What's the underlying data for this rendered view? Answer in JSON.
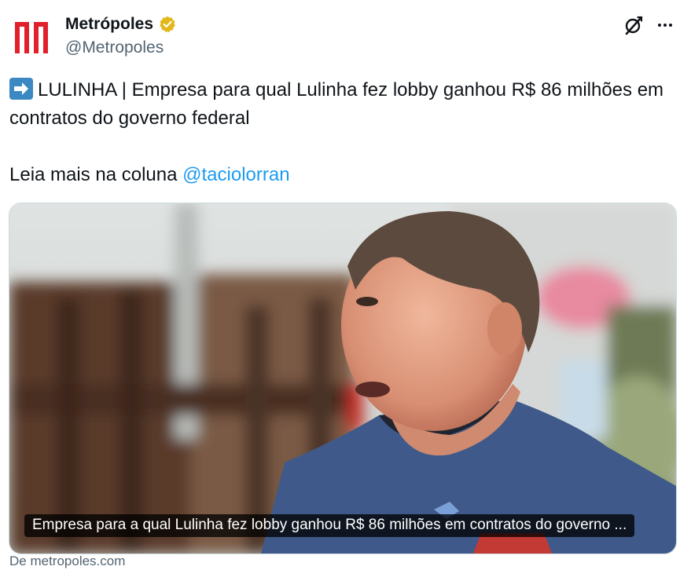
{
  "author": {
    "display_name": "Metrópoles",
    "handle": "@Metropoles",
    "avatar_icon": "metropoles-logo",
    "verified_badge": "gold-verified-badge"
  },
  "header_actions": {
    "grok_icon": "grok-icon",
    "more_icon": "more-dots-icon"
  },
  "tweet": {
    "emoji": "right-arrow-emoji",
    "line1": "LULINHA | Empresa para qual Lulinha fez lobby ganhou R$ 86 milhões em contratos do governo federal",
    "line2_prefix": "Leia mais na coluna ",
    "mention": "@taciolorran"
  },
  "link_card": {
    "title": "Empresa para a qual Lulinha fez lobby ganhou R$ 86 milhões em contratos do governo ...",
    "image": "photo-of-man-in-blue-tshirt",
    "from_text": "De metropoles.com"
  },
  "colors": {
    "brand_red": "#e0212b",
    "link_blue": "#1d9bf0",
    "secondary_text": "#536471",
    "verified_gold": "#e2b719"
  }
}
